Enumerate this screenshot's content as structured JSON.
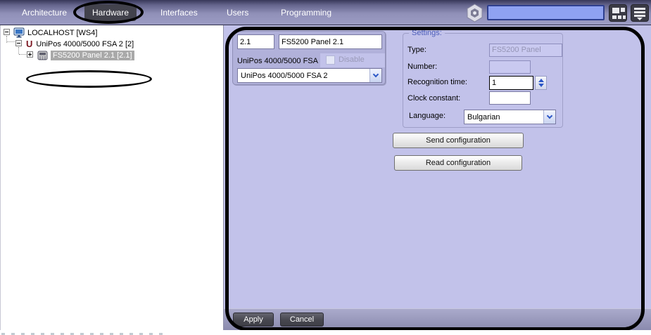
{
  "menu": {
    "items": [
      {
        "label": "Architecture",
        "selected": false
      },
      {
        "label": "Hardware",
        "selected": true
      },
      {
        "label": "Interfaces",
        "selected": false
      },
      {
        "label": "Users",
        "selected": false
      },
      {
        "label": "Programming",
        "selected": false
      }
    ]
  },
  "topbar": {
    "search": {
      "value": "",
      "placeholder": ""
    },
    "icons": {
      "hex": "module-hex-icon",
      "grid": "layout-grid-icon",
      "burger": "hamburger-menu-icon"
    }
  },
  "tree": {
    "nodes": [
      {
        "label": "LOCALHOST [WS4]",
        "expander": "minus",
        "icon": "monitor-icon",
        "selected": false
      },
      {
        "label": "UniPos 4000/5000 FSA 2 [2]",
        "expander": "minus",
        "icon": "unipos-u-icon",
        "selected": false
      },
      {
        "label": "FS5200 Panel 2.1 [2.1]",
        "expander": "plus",
        "icon": "panel-icon",
        "selected": true
      }
    ],
    "u_glyph": "U"
  },
  "panel": {
    "identity": {
      "id_value": "2.1",
      "name_value": "FS5200 Panel 2.1",
      "parent_label": "UniPos 4000/5000 FSA",
      "disable_label": "Disable",
      "disable_checked": false,
      "parent_value": "UniPos 4000/5000 FSA 2"
    },
    "settings": {
      "title": "Settings:",
      "type_label": "Type:",
      "type_value": "FS5200 Panel",
      "number_label": "Number:",
      "number_value": "",
      "recognition_label": "Recognition time:",
      "recognition_value": "1",
      "clock_label": "Clock constant:",
      "clock_value": "",
      "language_label": "Language:",
      "language_value": "Bulgarian"
    },
    "buttons": {
      "send": "Send configuration",
      "read": "Read configuration",
      "apply": "Apply",
      "cancel": "Cancel"
    }
  },
  "colors": {
    "topbar_top": "#38385a",
    "topbar_bottom": "#9c9cc4",
    "selected_menu_bg": "#42424c",
    "panel_bg": "#c2c2ea",
    "subpanel_bg": "#b1b1da",
    "accent_blue": "#2b56c6",
    "settings_title_blue": "#4b5cb8",
    "search_bg": "#8fa2f2",
    "tree_selection_bg": "#a9a9a9",
    "annotation_color": "#000000"
  }
}
